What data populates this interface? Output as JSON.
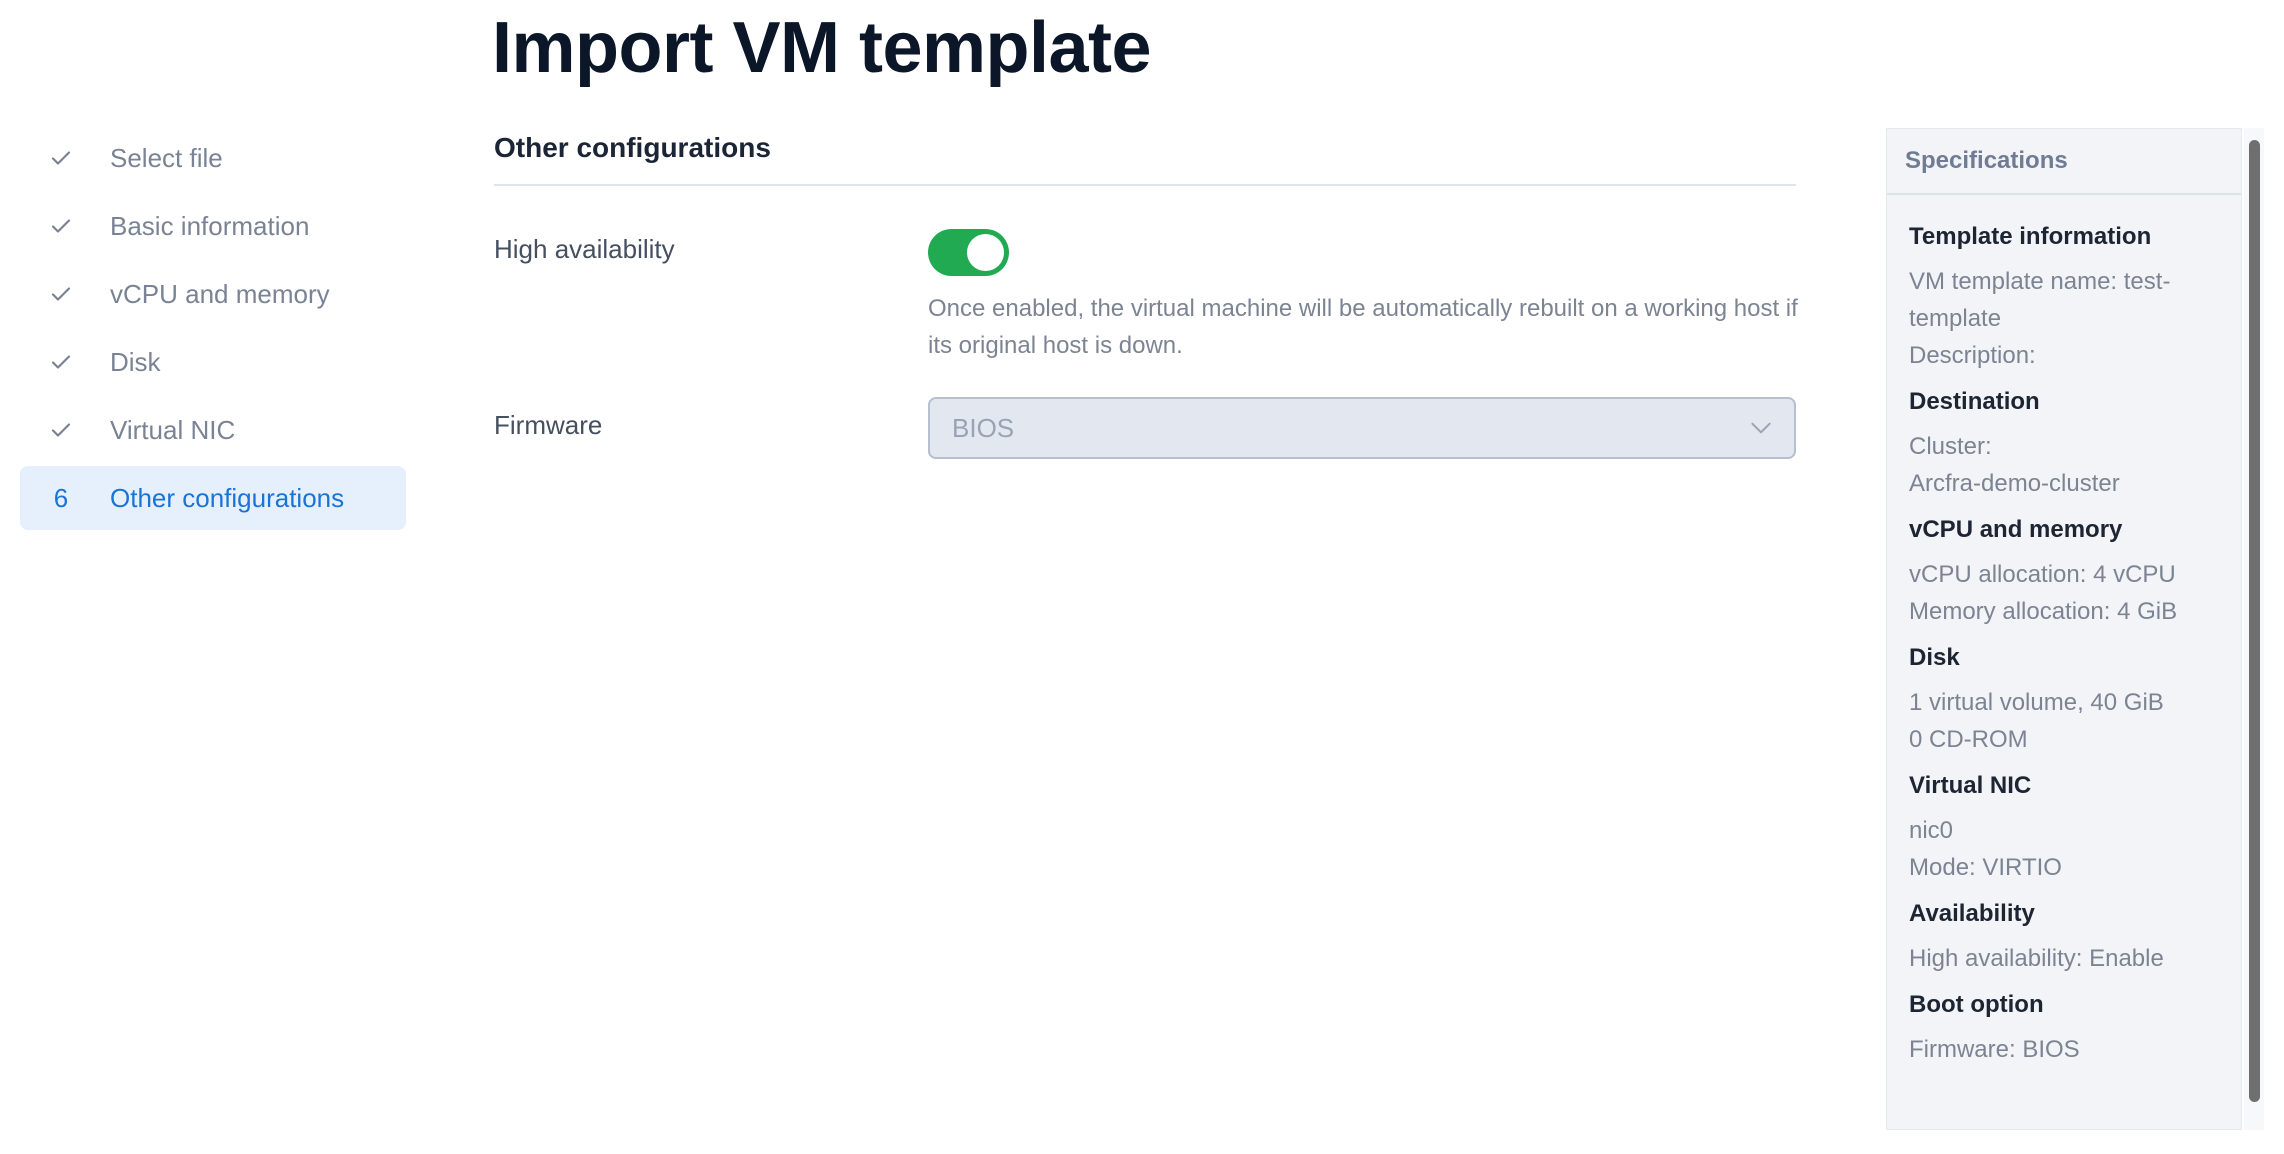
{
  "page": {
    "title": "Import VM template"
  },
  "steps": [
    {
      "marker": "✓",
      "label": "Select file",
      "done": true
    },
    {
      "marker": "✓",
      "label": "Basic information",
      "done": true
    },
    {
      "marker": "✓",
      "label": "vCPU and memory",
      "done": true
    },
    {
      "marker": "✓",
      "label": "Disk",
      "done": true
    },
    {
      "marker": "✓",
      "label": "Virtual NIC",
      "done": true
    },
    {
      "marker": "6",
      "label": "Other configurations",
      "active": true
    }
  ],
  "form": {
    "section_title": "Other configurations",
    "high_availability": {
      "label": "High availability",
      "enabled": true,
      "help": "Once enabled, the virtual machine will be automatically rebuilt on a working host if its original host is down."
    },
    "firmware": {
      "label": "Firmware",
      "value": "BIOS",
      "disabled": true
    }
  },
  "specs": {
    "title": "Specifications",
    "template_info": {
      "heading": "Template information",
      "name_line": "VM template name: test-template",
      "description_line": "Description:"
    },
    "destination": {
      "heading": "Destination",
      "cluster_label": "Cluster:",
      "cluster_value": "Arcfra-demo-cluster"
    },
    "vcpu_memory": {
      "heading": "vCPU and memory",
      "vcpu_line": "vCPU allocation: 4 vCPU",
      "memory_line": "Memory allocation: 4 GiB"
    },
    "disk": {
      "heading": "Disk",
      "volumes_line": "1 virtual volume, 40 GiB",
      "cdrom_line": "0 CD-ROM"
    },
    "virtual_nic": {
      "heading": "Virtual NIC",
      "nic_line": "nic0",
      "mode_line": "Mode: VIRTIO"
    },
    "availability": {
      "heading": "Availability",
      "ha_line": "High availability: Enable"
    },
    "boot_option": {
      "heading": "Boot option",
      "firmware_line": "Firmware: BIOS"
    }
  },
  "colors": {
    "toggle_on": "#22aa52",
    "active_step_bg": "#e6f0fd",
    "active_step_text": "#1a73d6",
    "title_text": "#0b1628"
  },
  "icons": {
    "completed_step": "check-icon",
    "select_chevron": "chevron-down-icon"
  }
}
